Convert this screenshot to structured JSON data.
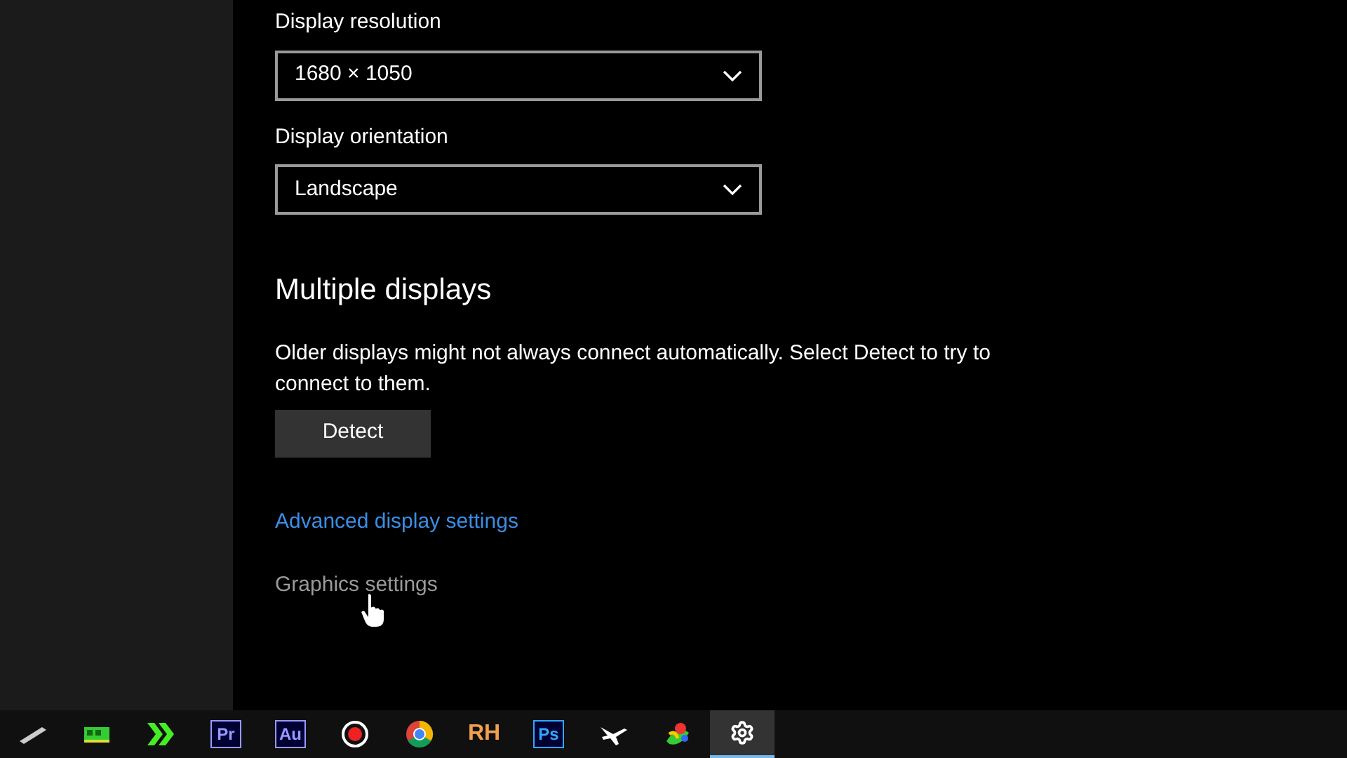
{
  "settings": {
    "resolution": {
      "label": "Display resolution",
      "value": "1680 × 1050"
    },
    "orientation": {
      "label": "Display orientation",
      "value": "Landscape"
    },
    "multiple_displays": {
      "heading": "Multiple displays",
      "description": "Older displays might not always connect automatically. Select Detect to try to connect to them.",
      "detect_button": "Detect"
    },
    "links": [
      {
        "text": "Advanced display settings",
        "kind": "link"
      },
      {
        "text": "Graphics settings",
        "kind": "plain"
      }
    ]
  },
  "taskbar": [
    {
      "kind": "pen",
      "selected": false
    },
    {
      "kind": "memory",
      "selected": false
    },
    {
      "kind": "arrows",
      "selected": false
    },
    {
      "kind": "badge",
      "label": "Pr",
      "color": "#9999ff",
      "selected": false
    },
    {
      "kind": "badge",
      "label": "Au",
      "color": "#9999ff",
      "selected": false
    },
    {
      "kind": "record",
      "selected": false
    },
    {
      "kind": "chrome",
      "selected": false
    },
    {
      "kind": "text",
      "label": "RH",
      "color": "#f0a050",
      "selected": false
    },
    {
      "kind": "badge",
      "label": "Ps",
      "color": "#31a8ff",
      "selected": false
    },
    {
      "kind": "plane",
      "selected": false
    },
    {
      "kind": "swirl",
      "selected": false
    },
    {
      "kind": "gear",
      "selected": true
    }
  ]
}
